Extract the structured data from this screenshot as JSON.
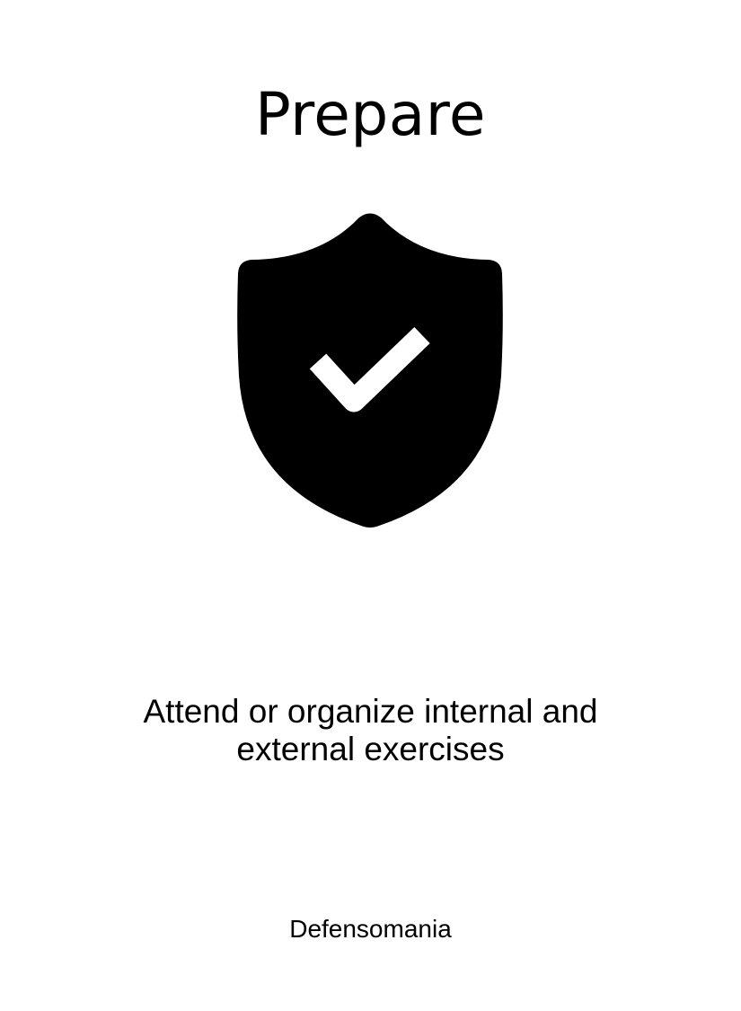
{
  "card": {
    "title": "Prepare",
    "icon": "shield-check-icon",
    "description": "Attend or organize internal and external exercises",
    "footer": "Defensomania"
  },
  "colors": {
    "background": "#ffffff",
    "foreground": "#000000"
  }
}
